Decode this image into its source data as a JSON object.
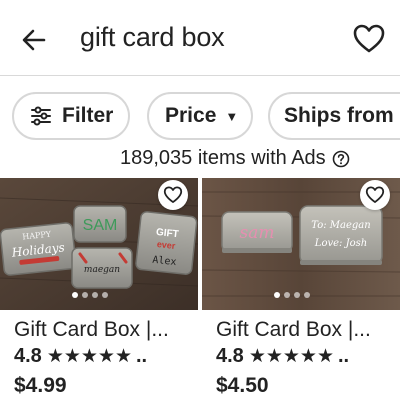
{
  "search": {
    "query": "gift card box",
    "back_icon": "arrow-left-icon",
    "wishlist_icon": "heart-outline-icon"
  },
  "filters": {
    "filter_label": "Filter",
    "price_label": "Price",
    "ships_label": "Ships from"
  },
  "results": {
    "count_text": "189,035 items with Ads",
    "info_icon": "question-circle-icon"
  },
  "listings": [
    {
      "title": "Gift Card Box |...",
      "rating": "4.8",
      "stars": "★★★★★",
      "more": "..",
      "price": "$4.99",
      "image_text": [
        "HAPPY",
        "Holidays",
        "SAM",
        "maegan",
        "GIFT",
        "ever",
        "Alex"
      ]
    },
    {
      "title": "Gift Card Box |...",
      "rating": "4.8",
      "stars": "★★★★★",
      "more": "..",
      "price": "$4.50",
      "image_text": [
        "sam",
        "To: Maegan",
        "Love: Josh"
      ]
    }
  ],
  "colors": {
    "text": "#222222",
    "divider": "#d9d9d9",
    "chip_border": "#d7d7d7",
    "wood_dark": "#4a3a30",
    "tin_silver": "#9a9a94"
  }
}
